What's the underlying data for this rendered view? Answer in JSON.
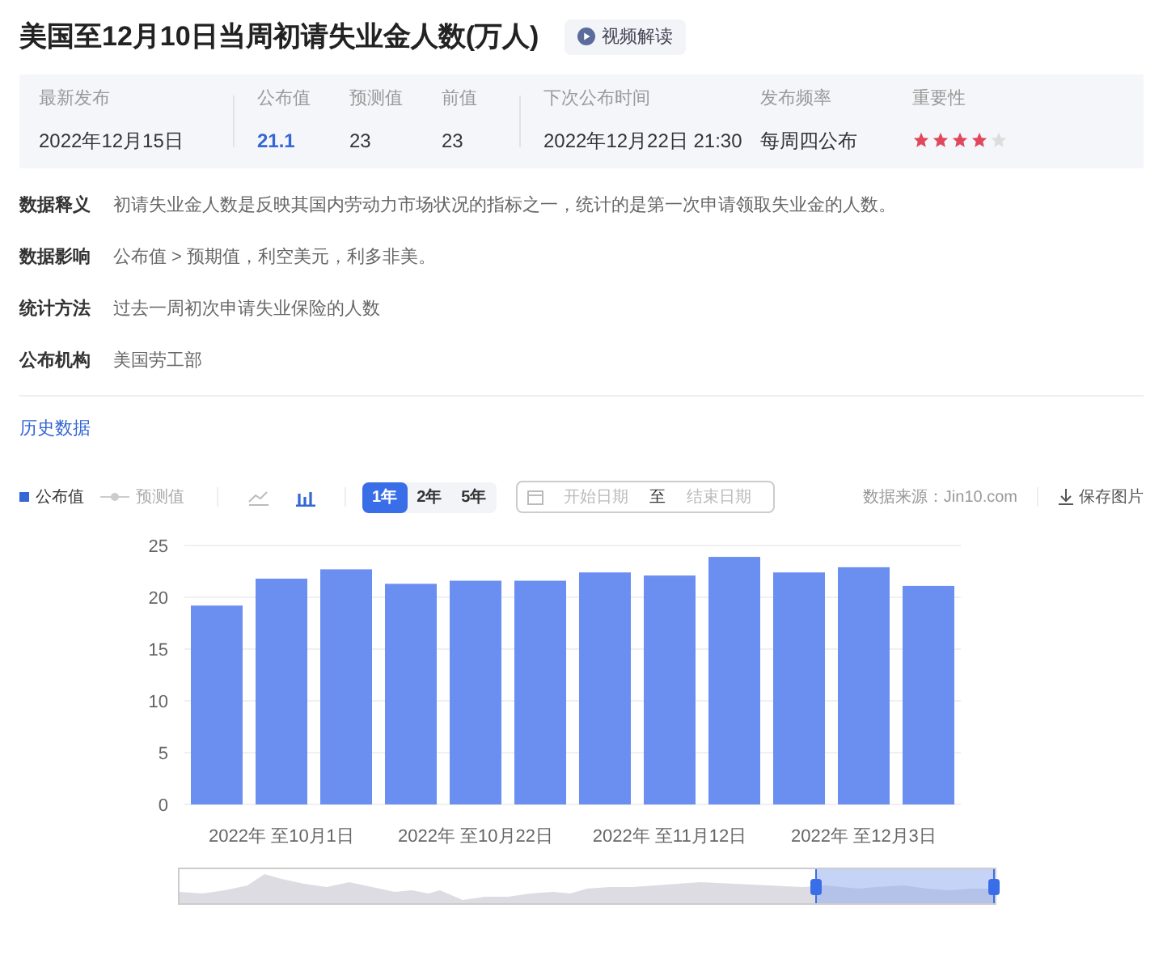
{
  "title": "美国至12月10日当周初请失业金人数(万人)",
  "video_button": "视频解读",
  "stats": [
    {
      "label": "最新发布",
      "value": "2022年12月15日",
      "kind": "plain"
    },
    {
      "label": "公布值",
      "value": "21.1",
      "kind": "highlight"
    },
    {
      "label": "预测值",
      "value": "23",
      "kind": "plain"
    },
    {
      "label": "前值",
      "value": "23",
      "kind": "plain"
    },
    {
      "label": "下次公布时间",
      "value": "2022年12月22日 21:30",
      "kind": "plain"
    },
    {
      "label": "发布频率",
      "value": "每周四公布",
      "kind": "plain"
    },
    {
      "label": "重要性",
      "stars": 4,
      "kind": "stars"
    }
  ],
  "definitions": [
    {
      "label": "数据释义",
      "text": "初请失业金人数是反映其国内劳动力市场状况的指标之一，统计的是第一次申请领取失业金的人数。"
    },
    {
      "label": "数据影响",
      "text": "公布值 > 预期值，利空美元，利多非美。"
    },
    {
      "label": "统计方法",
      "text": "过去一周初次申请失业保险的人数"
    },
    {
      "label": "公布机构",
      "text": "美国劳工部"
    }
  ],
  "section_title": "历史数据",
  "toolbar": {
    "legend": [
      {
        "kind": "square",
        "on": true
      },
      {
        "label": "预测值",
        "kind": "line",
        "on": false
      }
    ],
    "chart_types": [
      {
        "kind": "line",
        "selected": false
      },
      {
        "kind": "bar",
        "selected": true
      }
    ],
    "ranges": [
      {
        "label": "1年",
        "selected": true
      },
      {
        "label": "2年",
        "selected": false
      },
      {
        "label": "5年",
        "selected": false
      }
    ],
    "start_placeholder": "开始日期",
    "separator": "至",
    "end_placeholder": "结束日期",
    "source": "数据来源：Jin10.com",
    "save": "保存图片"
  },
  "chart_data": {
    "type": "bar",
    "grid": true,
    "categories": [
      null,
      "2022年 至10月1日",
      null,
      null,
      "2022年 至10月22日",
      null,
      null,
      "2022年 至11月12日",
      null,
      null,
      "2022年 至12月3日",
      null
    ],
    "series": [
      {
        "name": "公布值",
        "color": "#6a8ff0",
        "values": [
          19.2,
          21.8,
          22.7,
          21.3,
          21.6,
          21.6,
          22.4,
          22.1,
          23.9,
          22.4,
          22.9,
          21.1
        ]
      }
    ],
    "ylim": [
      0,
      25
    ],
    "yticks": [
      0,
      5,
      10,
      15,
      20,
      25
    ]
  }
}
